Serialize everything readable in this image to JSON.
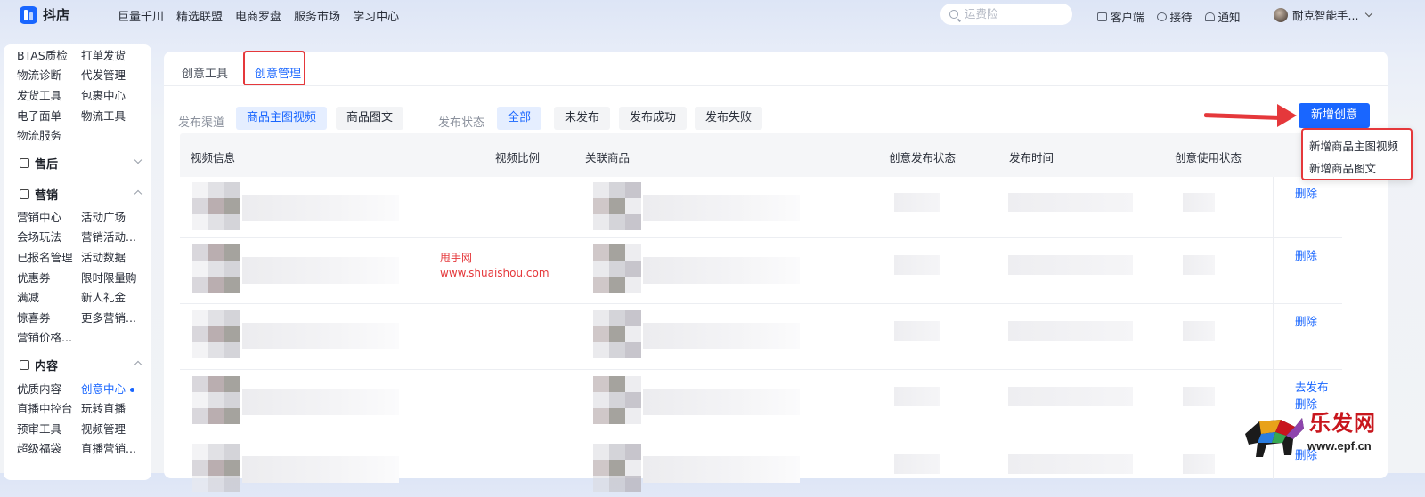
{
  "app": {
    "name": "抖店"
  },
  "topnav": [
    "巨量千川",
    "精选联盟",
    "电商罗盘",
    "服务市场",
    "学习中心"
  ],
  "search": {
    "placeholder": "运费险",
    "value": ""
  },
  "tools": {
    "client": "客户端",
    "reception": "接待",
    "notify": "通知"
  },
  "account": {
    "name": "耐克智能手..."
  },
  "sidebar": {
    "logistics_rows": [
      [
        "BTAS质检",
        "打单发货"
      ],
      [
        "物流诊断",
        "代发管理"
      ],
      [
        "发货工具",
        "包裹中心"
      ],
      [
        "电子面单",
        "物流工具"
      ],
      [
        "物流服务",
        ""
      ]
    ],
    "after_sale": {
      "title": "售后"
    },
    "marketing": {
      "title": "营销",
      "rows": [
        [
          "营销中心",
          "活动广场"
        ],
        [
          "会场玩法",
          "营销活动..."
        ],
        [
          "已报名管理",
          "活动数据"
        ],
        [
          "优惠券",
          "限时限量购"
        ],
        [
          "满减",
          "新人礼金"
        ],
        [
          "惊喜券",
          "更多营销..."
        ],
        [
          "营销价格...",
          ""
        ]
      ]
    },
    "content": {
      "title": "内容",
      "rows": [
        [
          "优质内容",
          "创意中心"
        ],
        [
          "直播中控台",
          "玩转直播"
        ],
        [
          "预审工具",
          "视频管理"
        ],
        [
          "超级福袋",
          "直播营销..."
        ]
      ],
      "active": "创意中心"
    }
  },
  "tabs": [
    "创意工具",
    "创意管理"
  ],
  "active_tab": "创意管理",
  "filters": {
    "channel_label": "发布渠道",
    "channels": [
      "商品主图视频",
      "商品图文"
    ],
    "active_channel": "商品主图视频",
    "status_label": "发布状态",
    "statuses": [
      "全部",
      "未发布",
      "发布成功",
      "发布失败"
    ],
    "active_status": "全部"
  },
  "new_button": "新增创意",
  "dropdown": [
    "新增商品主图视频",
    "新增商品图文"
  ],
  "table": {
    "headers": [
      "视频信息",
      "视频比例",
      "关联商品",
      "创意发布状态",
      "发布时间",
      "创意使用状态"
    ],
    "row_actions": [
      [
        "删除"
      ],
      [
        "删除"
      ],
      [
        "删除"
      ],
      [
        "去发布",
        "删除"
      ],
      [
        "删除"
      ]
    ]
  },
  "watermark": {
    "line1": "甩手网",
    "line2": "www.shuaishou.com"
  },
  "ad_logo": {
    "text": "乐发网",
    "url": "www.epf.cn"
  },
  "colors": {
    "accent": "#1966ff",
    "highlight": "#e5383b"
  }
}
